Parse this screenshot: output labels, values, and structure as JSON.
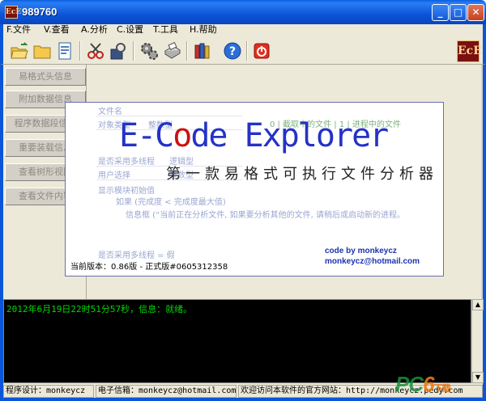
{
  "window": {
    "title": "989760",
    "app_icon": "EcE",
    "buttons": {
      "minimize": "_",
      "maximize": "□",
      "close": "✕"
    }
  },
  "menu": [
    {
      "label": "F.文件"
    },
    {
      "label": "V.查看"
    },
    {
      "label": "A.分析"
    },
    {
      "label": "C.设置"
    },
    {
      "label": "T.工具"
    },
    {
      "label": "H.帮助"
    }
  ],
  "toolbar": {
    "icons": [
      "open-folder-icon",
      "folder-icon",
      "document-icon",
      "cut-tool-icon",
      "inspect-icon",
      "settings-gears-icon",
      "print-icon",
      "books-icon",
      "help-icon",
      "power-icon"
    ],
    "brand": "EcE"
  },
  "nav": [
    {
      "label": "易格式头信息"
    },
    {
      "label": "附加数据信息"
    },
    {
      "label": "程序数据段信息"
    },
    {
      "label": "重要装载信息"
    },
    {
      "label": "查看树形视图"
    },
    {
      "label": "查看文件内容"
    }
  ],
  "splash": {
    "logo_prefix": "E-C",
    "logo_o": "o",
    "logo_suffix": "de Explorer",
    "seal_text": "第一款易格式可执行文件分析器",
    "credit_line1": "code by monkeycz",
    "credit_line2": "monkeycz@hotmail.com",
    "version_text": "当前版本：0.86版 - 正式版#0605312358",
    "ghost": {
      "row1": "文件名",
      "row2": "对象类型",
      "row2_val": "整数型",
      "right_text": "0 | 截取中的文件 | 1 | 进程中的文件",
      "row3": "是否采用多线程",
      "row3_val": "逻辑型",
      "row4": "用户选择",
      "row4_val": "整数型",
      "code1": "显示模块初始值",
      "code2": "如果 (完成度 < 完成度最大值)",
      "code3": "信息框 (“当前正在分析文件, 如果要分析其他的文件, 请稍后或启动新的进程。",
      "code4": "是否采用多线程 = 假"
    }
  },
  "log": {
    "line": "2012年6月19日22时51分57秒，信息：就绪。"
  },
  "status": [
    {
      "text": "程序设计：monkeycz"
    },
    {
      "text": "电子信箱：monkeycz@hotmail.com"
    },
    {
      "text": "欢迎访问本软件的官方网站：http://monkeycz.pedy.com"
    }
  ],
  "watermark": {
    "pc": "PC",
    "six": "6",
    "rest": "下载"
  }
}
